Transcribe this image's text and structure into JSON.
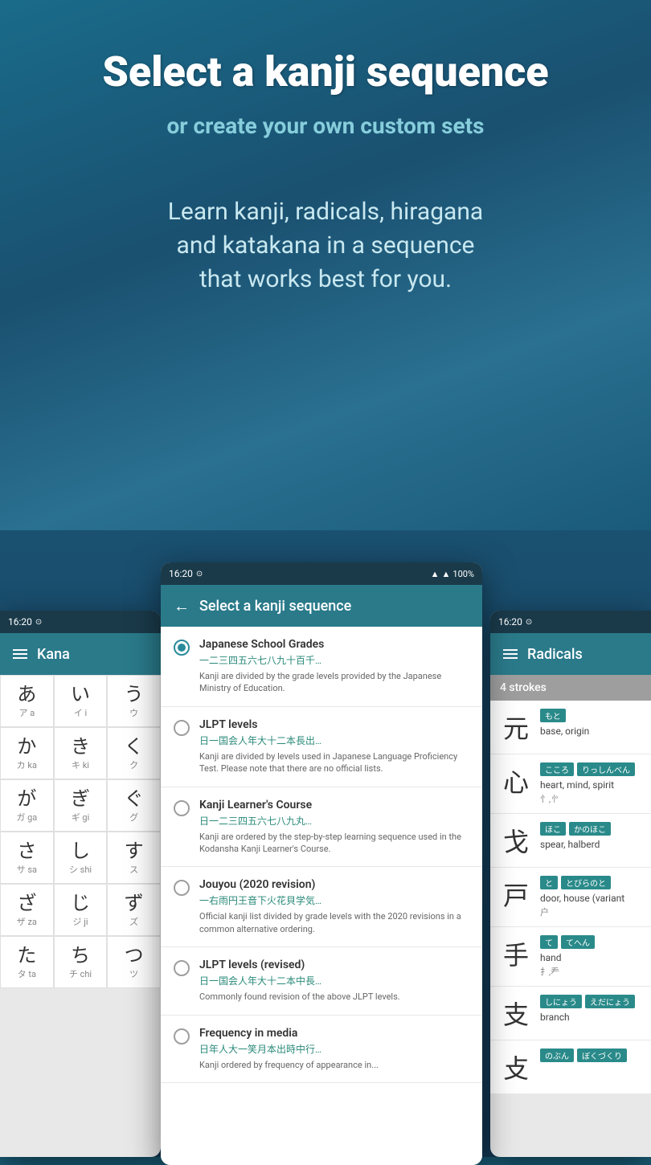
{
  "hero": {
    "title": "Select a kanji sequence",
    "subtitle": "or create your own custom sets",
    "description": "Learn kanji, radicals, hiragana\nand katakana in a sequence\nthat works best for you."
  },
  "phones": {
    "left": {
      "status_time": "16:20",
      "title": "Kana",
      "kana_cells": [
        {
          "char": "あ",
          "roman": "ア  a"
        },
        {
          "char": "い",
          "roman": "イ  i"
        },
        {
          "char": "う",
          "roman": "ウ"
        },
        {
          "char": "か",
          "roman": "カ  ka"
        },
        {
          "char": "き",
          "roman": "キ  ki"
        },
        {
          "char": "く",
          "roman": "ク"
        },
        {
          "char": "が",
          "roman": "ガ  ga"
        },
        {
          "char": "ぎ",
          "roman": "ギ  gi"
        },
        {
          "char": "ぐ",
          "roman": "グ"
        },
        {
          "char": "さ",
          "roman": "サ  sa"
        },
        {
          "char": "し",
          "roman": "シ  shi"
        },
        {
          "char": "す",
          "roman": "ス"
        },
        {
          "char": "ざ",
          "roman": "ザ  za"
        },
        {
          "char": "じ",
          "roman": "ジ  ji"
        },
        {
          "char": "ず",
          "roman": "ズ"
        },
        {
          "char": "た",
          "roman": "タ  ta"
        },
        {
          "char": "ち",
          "roman": "チ  chi"
        },
        {
          "char": "つ",
          "roman": "ツ"
        }
      ]
    },
    "center": {
      "status_time": "16:20",
      "title": "Select a kanji sequence",
      "sequences": [
        {
          "id": "japanese-school",
          "title": "Japanese School Grades",
          "kanji": "一二三四五六七八九十百千…",
          "desc": "Kanji are divided by the grade levels provided by the Japanese Ministry of Education.",
          "selected": true
        },
        {
          "id": "jlpt",
          "title": "JLPT levels",
          "kanji": "日一国会人年大十二本長出…",
          "desc": "Kanji are divided by levels used in Japanese Language Proficiency Test. Please note that there are no official lists.",
          "selected": false
        },
        {
          "id": "kanji-learners",
          "title": "Kanji Learner's Course",
          "kanji": "日一二三四五六七八九丸…",
          "desc": "Kanji are ordered by the step-by-step learning sequence used in the Kodansha Kanji Learner's Course.",
          "selected": false
        },
        {
          "id": "jouyou",
          "title": "Jouyou (2020 revision)",
          "kanji": "一右雨円王音下火花貝学気…",
          "desc": "Official kanji list divided by grade levels with the 2020 revisions in a common alternative ordering.",
          "selected": false
        },
        {
          "id": "jlpt-revised",
          "title": "JLPT levels (revised)",
          "kanji": "日一国会人年大十二本中長…",
          "desc": "Commonly found revision of the above JLPT levels.",
          "selected": false
        },
        {
          "id": "frequency",
          "title": "Frequency in media",
          "kanji": "日年人大一笑月本出時中行…",
          "desc": "Kanji ordered by frequency of appearance in...",
          "selected": false
        }
      ]
    },
    "right": {
      "status_time": "16:20",
      "title": "Radicals",
      "section": "4 strokes",
      "radicals": [
        {
          "char": "元",
          "tags": [
            "もと"
          ],
          "meaning": "base, origin",
          "sub": ""
        },
        {
          "char": "心",
          "tags": [
            "こころ",
            "りっしんべん"
          ],
          "meaning": "heart, mind, spirit",
          "sub": "忄,㣺"
        },
        {
          "char": "戈",
          "tags": [
            "ほこ",
            "かのほこ"
          ],
          "meaning": "spear, halberd",
          "sub": ""
        },
        {
          "char": "戸",
          "tags": [
            "と",
            "とびらのと"
          ],
          "meaning": "door, house (variant",
          "sub": "户"
        },
        {
          "char": "手",
          "tags": [
            "て",
            "てへん"
          ],
          "meaning": "hand",
          "sub": "扌,龵"
        },
        {
          "char": "支",
          "tags": [
            "しにょう",
            "えだにょう"
          ],
          "meaning": "branch",
          "sub": ""
        },
        {
          "char": "攴",
          "tags": [
            "のぶん",
            "ぼくづくり"
          ],
          "meaning": "",
          "sub": ""
        }
      ]
    }
  }
}
